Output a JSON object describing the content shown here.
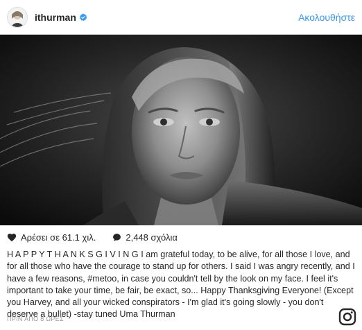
{
  "header": {
    "username": "ithurman",
    "follow_label": "Ακολουθήστε"
  },
  "photo": {
    "description_icon": "black-and-white-portrait-photo"
  },
  "actions": {
    "likes_text": "Αρέσει σε 61.1 χιλ.",
    "comments_text": "2,448 σχόλια"
  },
  "caption": {
    "text": "H A P P Y T H A N K S G I V I N G I am grateful today, to be alive, for all those I love, and for all those who have the courage to stand up for others. I said I was angry recently, and I have a few reasons, #metoo, in case you couldn't tell by the look on my face. I feel it's important to take your time, be fair, be exact, so... Happy Thanksgiving Everyone! (Except you Harvey, and all your wicked conspirators - I'm glad it's going slowly - you don't deserve a bullet) -stay tuned Uma Thurman"
  },
  "timestamp": {
    "text": "ΠΡΙΝ ΑΠΟ 8 ΩΡΕΣ"
  },
  "colors": {
    "link_blue": "#3897f0",
    "verified_blue": "#3897f0",
    "text": "#262626",
    "muted": "#999999"
  },
  "icons": {
    "verified": "verified-badge-icon",
    "heart": "heart-icon",
    "comment": "comment-bubble-icon",
    "instagram": "instagram-logo-icon"
  }
}
